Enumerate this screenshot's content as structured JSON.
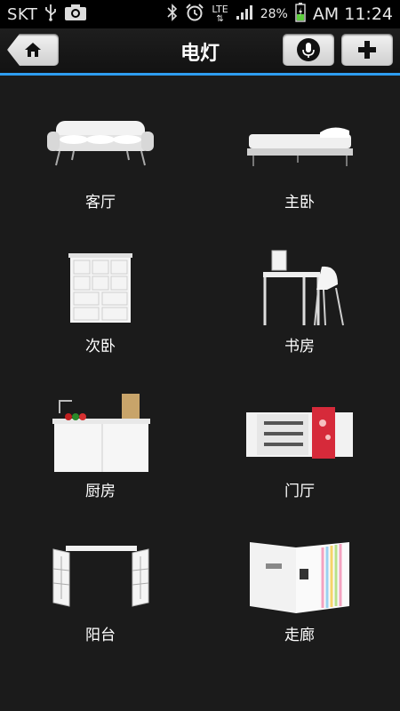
{
  "status_bar": {
    "carrier": "SKT",
    "network": "LTE",
    "battery": "28%",
    "time": "AM 11:24"
  },
  "header": {
    "title": "电灯"
  },
  "rooms": [
    {
      "label": "客厅",
      "icon": "sofa"
    },
    {
      "label": "主卧",
      "icon": "bed"
    },
    {
      "label": "次卧",
      "icon": "drawer-cabinet"
    },
    {
      "label": "书房",
      "icon": "desk-chair"
    },
    {
      "label": "厨房",
      "icon": "kitchen-counter"
    },
    {
      "label": "门厅",
      "icon": "entrance-cabinet"
    },
    {
      "label": "阳台",
      "icon": "balcony-door"
    },
    {
      "label": "走廊",
      "icon": "corridor-wall"
    }
  ],
  "colors": {
    "background": "#1b1b1b",
    "accent_line": "#2e9df0"
  }
}
